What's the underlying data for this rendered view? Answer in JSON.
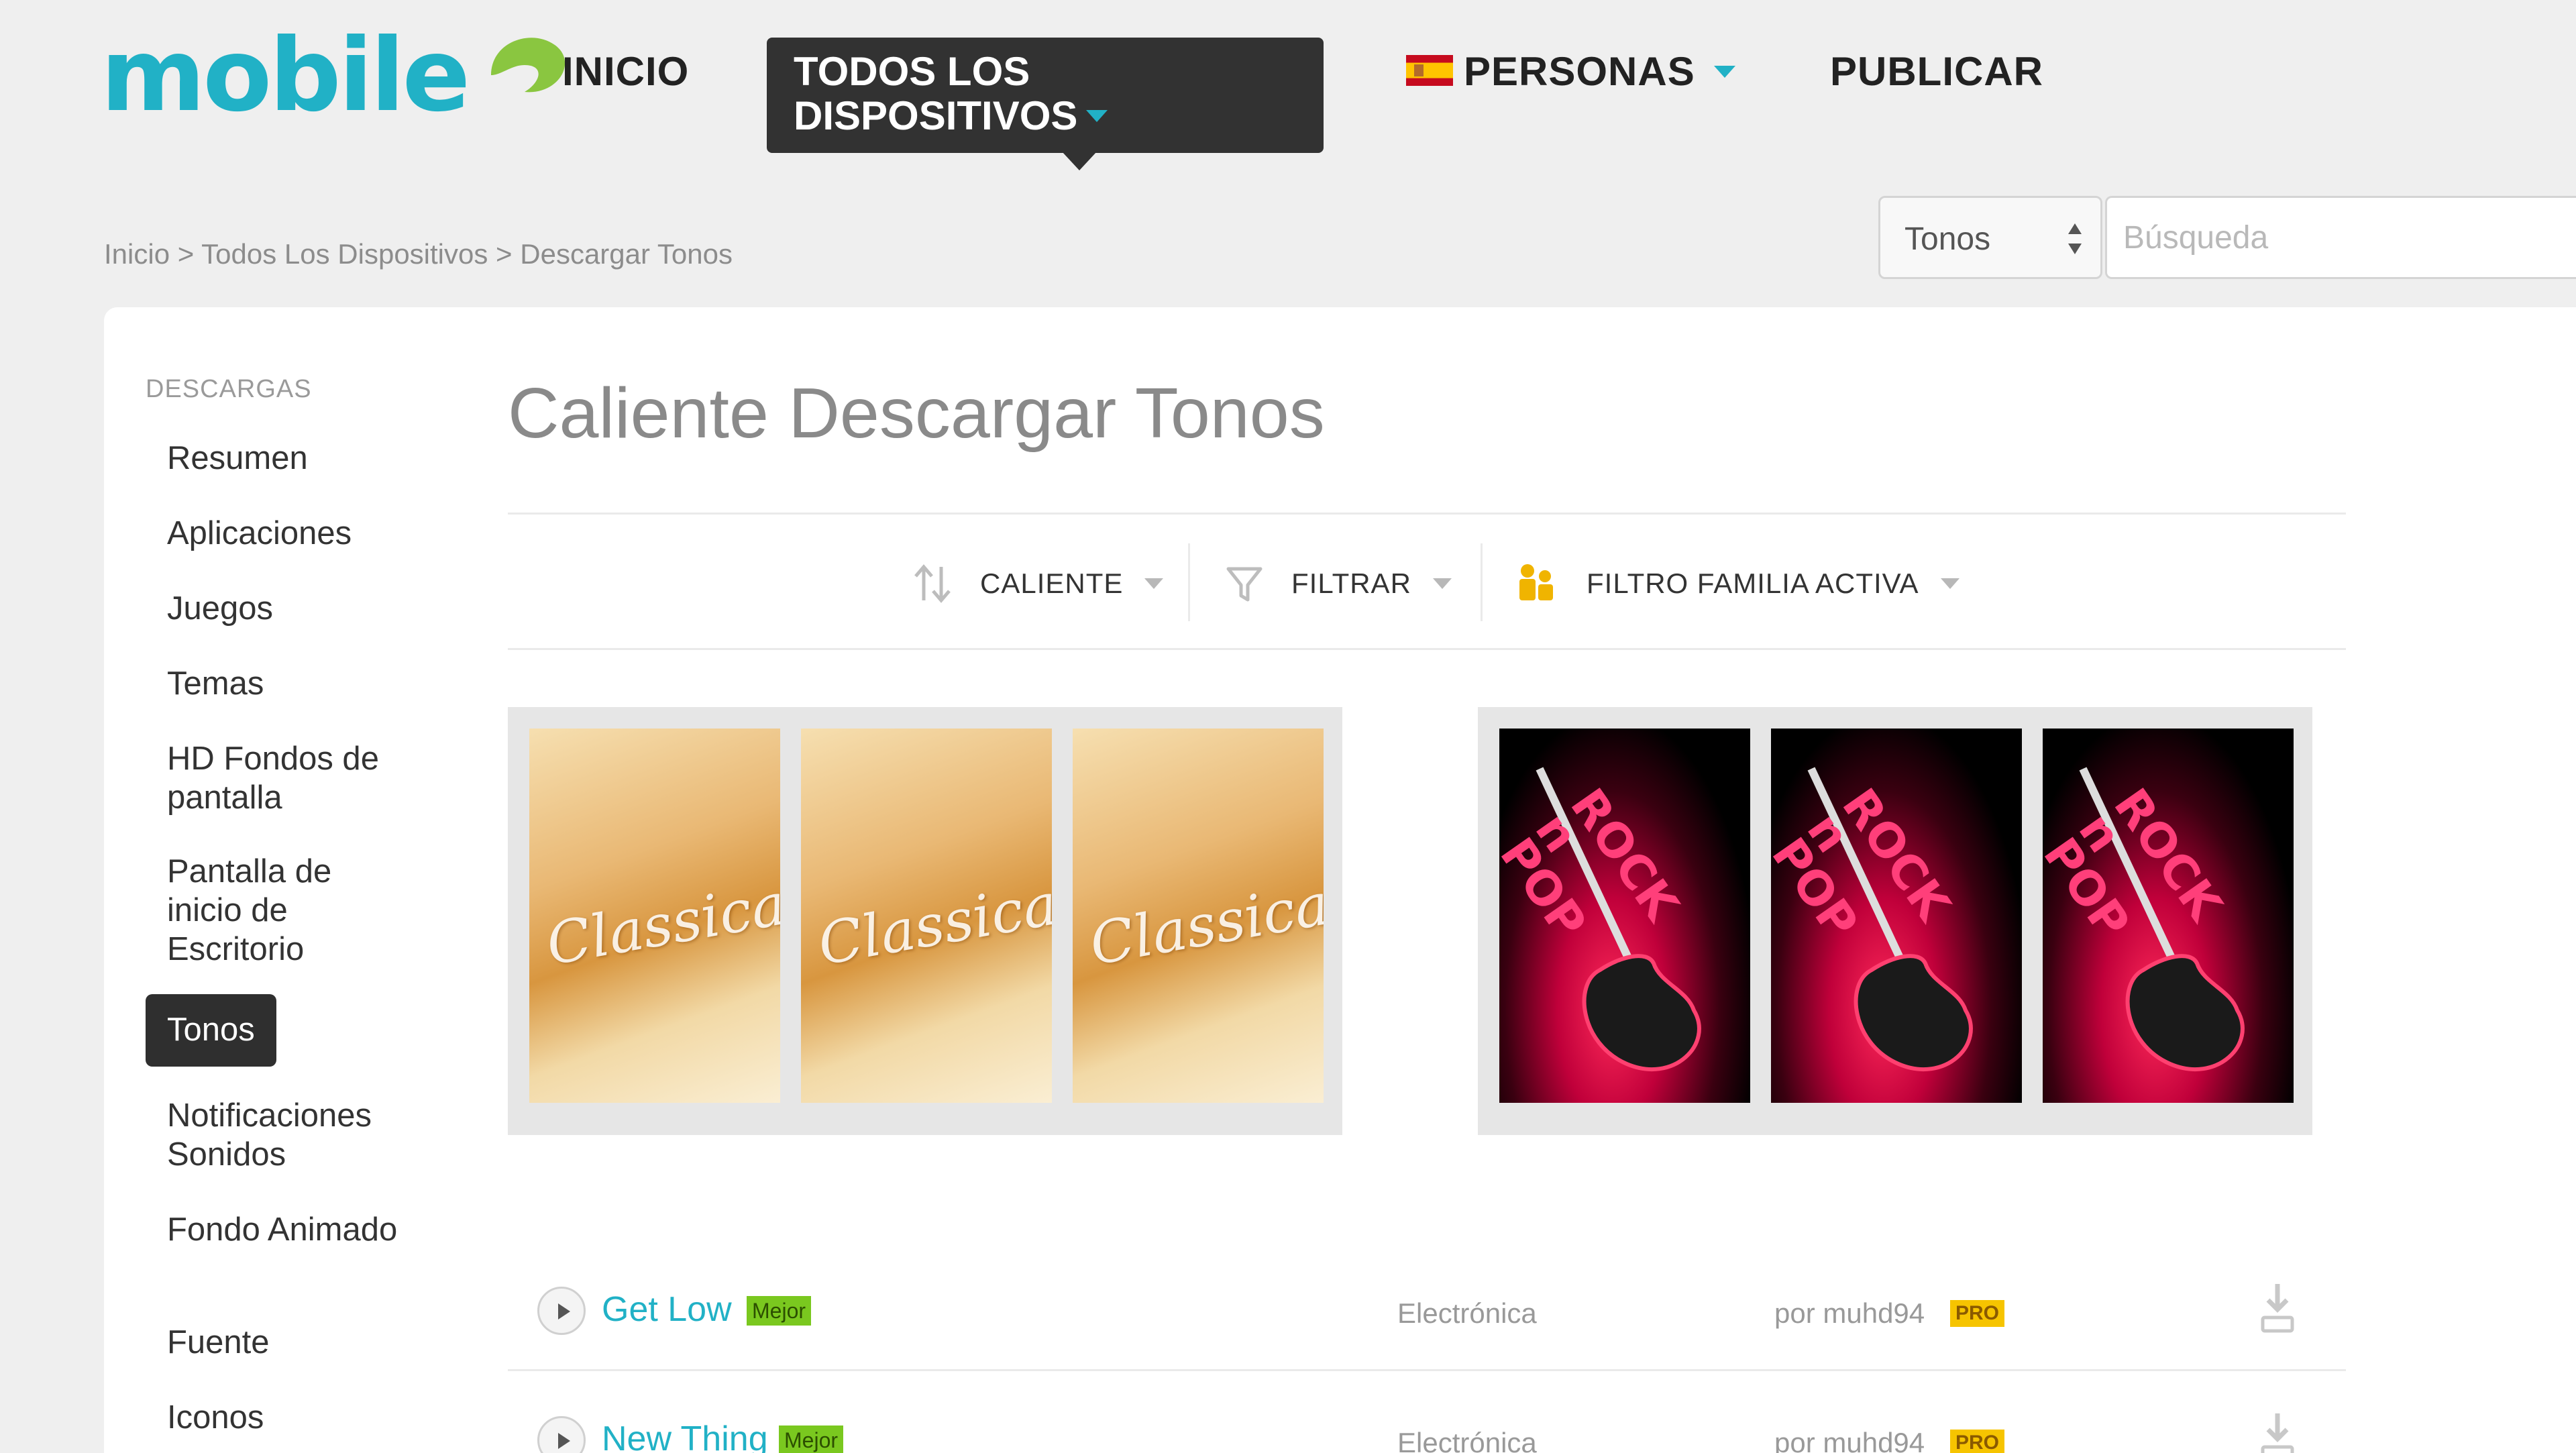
{
  "brand": {
    "logo": "mobile",
    "accent": "#21b1c6"
  },
  "nav": {
    "inicio": "INICIO",
    "devices": "TODOS LOS DISPOSITIVOS",
    "personas": "PERSONAS",
    "publicar": "PUBLICAR"
  },
  "breadcrumb": {
    "home": "Inicio",
    "sep1": " > ",
    "devices": "Todos Los Dispositivos",
    "sep2": " > ",
    "current": "Descargar Tonos"
  },
  "search": {
    "category": "Tonos",
    "placeholder": "Búsqueda"
  },
  "sidebar": {
    "title": "DESCARGAS",
    "items": [
      {
        "label": "Resumen"
      },
      {
        "label": "Aplicaciones"
      },
      {
        "label": "Juegos"
      },
      {
        "label": "Temas"
      },
      {
        "label": "HD Fondos de pantalla"
      },
      {
        "label": "Pantalla de inicio de Escritorio"
      },
      {
        "label": "Tonos",
        "active": true
      },
      {
        "label": "Notificaciones Sonidos"
      },
      {
        "label": "Fondo Animado"
      },
      {
        "label": "Fuente"
      },
      {
        "label": "Iconos"
      }
    ]
  },
  "main": {
    "title": "Caliente Descargar Tonos",
    "filters": {
      "sort": "CALIENTE",
      "filter": "FILTRAR",
      "family": "FILTRO FAMILIA ACTIVA"
    },
    "banners": [
      {
        "art_text": "Classical"
      },
      {
        "art_text": "ROCK n POP"
      }
    ],
    "rows": [
      {
        "title": "Get Low",
        "badge": "Mejor",
        "genre": "Electrónica",
        "author": "por muhd94",
        "author_badge": "PRO"
      },
      {
        "title": "New Thing",
        "badge": "Mejor",
        "genre": "Electrónica",
        "author": "por muhd94",
        "author_badge": "PRO"
      }
    ]
  }
}
